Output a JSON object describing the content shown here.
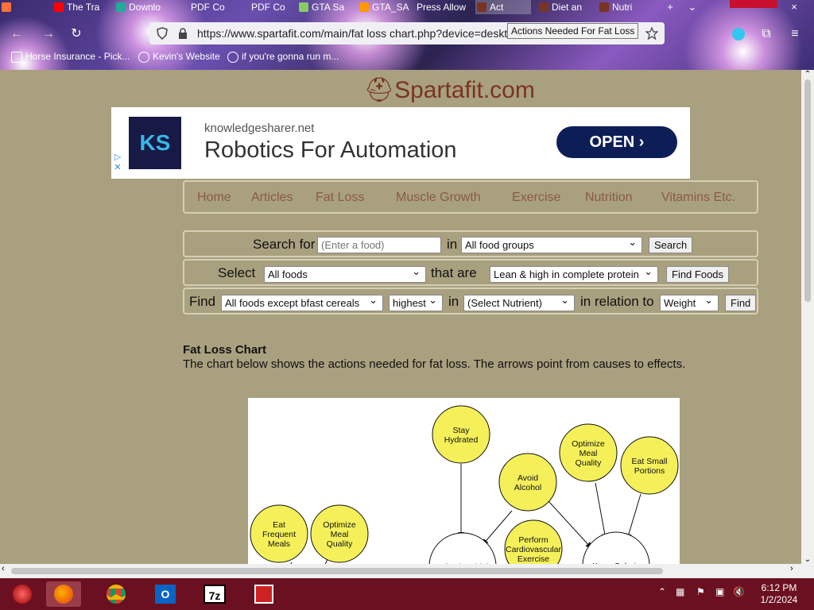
{
  "browser": {
    "tabs": [
      "The Tra",
      "Downlo",
      "PDF Co",
      "PDF Co",
      "GTA Sa",
      "GTA_SA",
      "Press Allow",
      "Act",
      "Diet an",
      "Nutri"
    ],
    "url": "https://www.spartafit.com/main/fat loss chart.php?device=deskt",
    "tooltip": "Actions Needed For Fat Loss",
    "bookmarks": [
      "Horse Insurance - Pick...",
      "Kevin's Website",
      "if you're gonna run m..."
    ]
  },
  "site": {
    "logo": "Spartafit.com"
  },
  "ad": {
    "logo_text": "KS",
    "domain": "knowledgesharer.net",
    "headline": "Robotics For Automation",
    "cta": "OPEN ›"
  },
  "menu": [
    "Home",
    "Articles",
    "Fat Loss",
    "Muscle Growth",
    "Exercise",
    "Nutrition",
    "Vitamins Etc."
  ],
  "search": {
    "label": "Search for",
    "placeholder": "(Enter a food)",
    "in": "in",
    "group": "All food groups",
    "button": "Search"
  },
  "select": {
    "label": "Select",
    "foods": "All foods",
    "that_are": "that are",
    "criteria": "Lean & high in complete protein",
    "button": "Find Foods"
  },
  "find": {
    "label": "Find",
    "foods": "All foods except bfast cereals",
    "order": "highest",
    "in": "in",
    "nutrient": "(Select Nutrient)",
    "relation": "in relation to",
    "basis": "Weight",
    "button": "Find"
  },
  "article": {
    "title": "Fat Loss Chart",
    "description": "The chart below shows the actions needed for fat loss. The arrows point from causes to effects."
  },
  "diagram": {
    "nodes": [
      {
        "id": "stay-hydrated",
        "label": [
          "Stay",
          "Hydrated"
        ]
      },
      {
        "id": "optimize-meal-quality-1",
        "label": [
          "Optimize",
          "Meal",
          "Quality"
        ]
      },
      {
        "id": "eat-small-portions",
        "label": [
          "Eat Small",
          "Portions"
        ]
      },
      {
        "id": "avoid-alcohol",
        "label": [
          "Avoid",
          "Alcohol"
        ]
      },
      {
        "id": "eat-frequent-meals",
        "label": [
          "Eat",
          "Frequent",
          "Meals"
        ]
      },
      {
        "id": "optimize-meal-quality-2",
        "label": [
          "Optimize",
          "Meal",
          "Quality"
        ]
      },
      {
        "id": "perform-cardio",
        "label": [
          "Perform",
          "Cardiovascular",
          "Exercise"
        ]
      },
      {
        "id": "maintain-high",
        "label": [
          "Maintain a high"
        ]
      },
      {
        "id": "keep-caloric",
        "label": [
          "Keep Caloric"
        ]
      }
    ]
  },
  "taskbar": {
    "time": "6:12 PM",
    "date": "1/2/2024"
  }
}
